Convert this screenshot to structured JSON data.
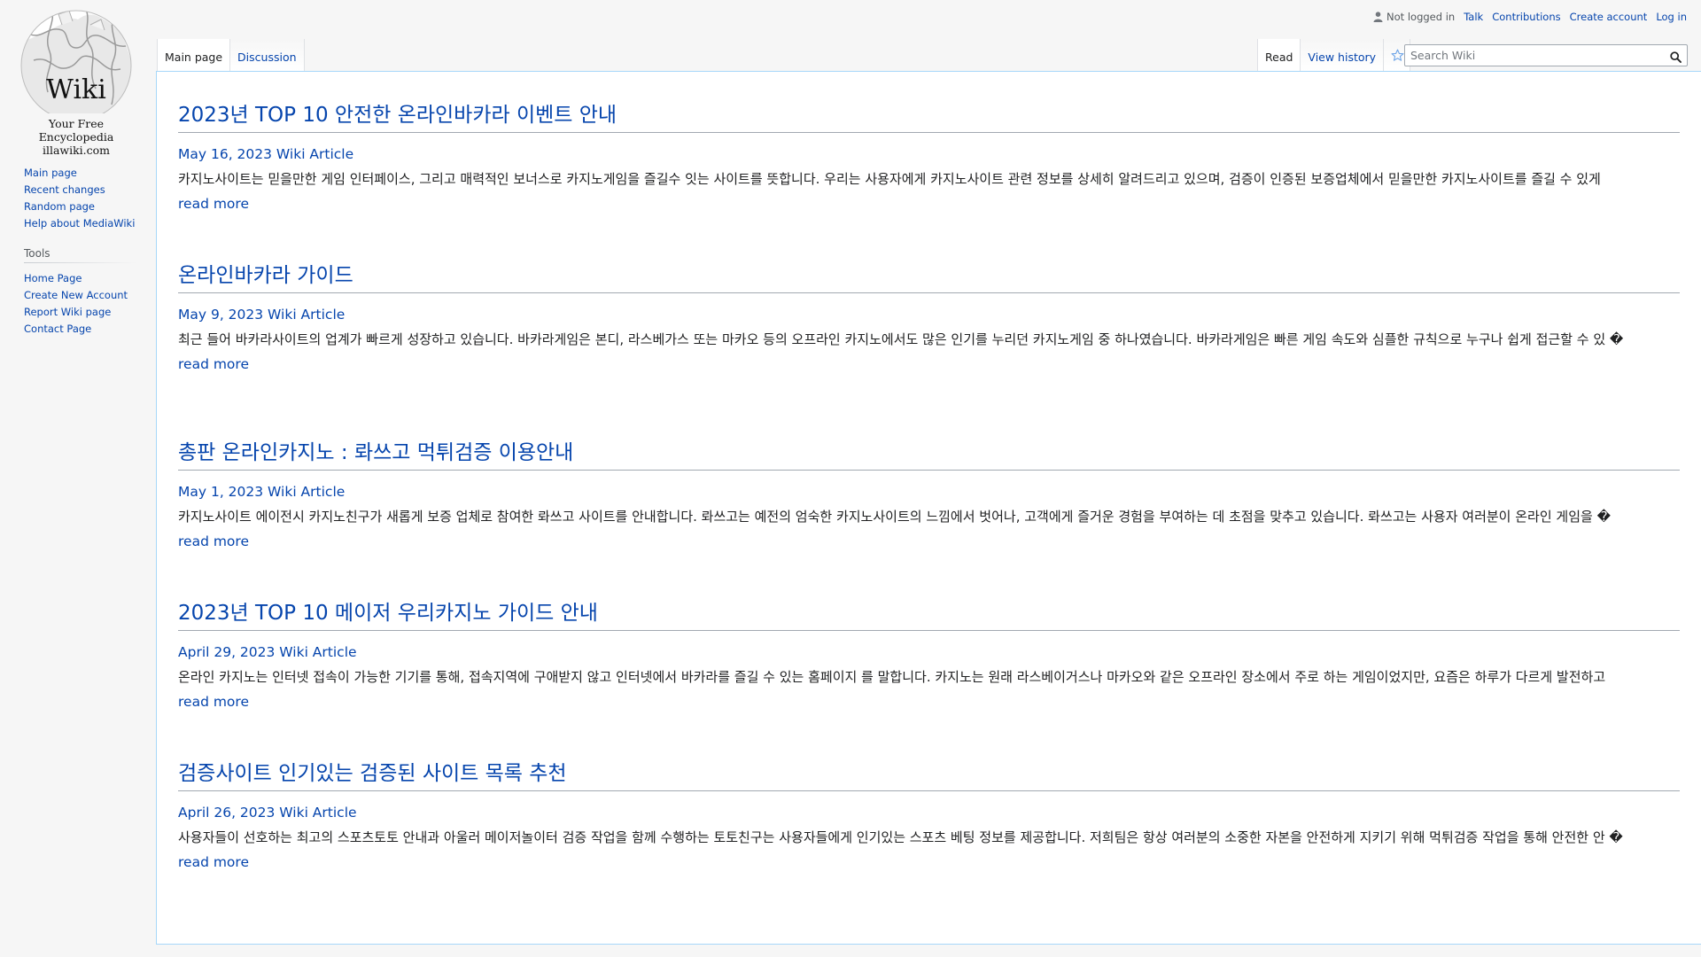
{
  "logo": {
    "word": "Wiki",
    "tagline": "Your Free Encyclopedia",
    "domain": "illawiki.com"
  },
  "sidebar": {
    "navigation": [
      {
        "label": "Main page"
      },
      {
        "label": "Recent changes"
      },
      {
        "label": "Random page"
      },
      {
        "label": "Help about MediaWiki"
      }
    ],
    "tools_heading": "Tools",
    "tools": [
      {
        "label": "Home Page"
      },
      {
        "label": "Create New Account"
      },
      {
        "label": "Report Wiki page"
      },
      {
        "label": "Contact Page"
      }
    ]
  },
  "personal": {
    "not_logged_in": "Not logged in",
    "talk": "Talk",
    "contributions": "Contributions",
    "create_account": "Create account",
    "log_in": "Log in"
  },
  "tabs": {
    "main_page": "Main page",
    "discussion": "Discussion",
    "read": "Read",
    "view_history": "View history"
  },
  "search": {
    "placeholder": "Search Wiki"
  },
  "articles": [
    {
      "title": "2023년 TOP 10 안전한 온라인바카라 이벤트 안내",
      "meta": "May 16, 2023 Wiki Article",
      "excerpt": "카지노사이트는  믿을만한 게임 인터페이스, 그리고 매력적인 보너스로 카지노게임을 즐길수 잇는 사이트를 뜻합니다. 우리는 사용자에게 카지노사이트 관련 정보를 상세히 알려드리고 있으며, 검증이 인증된 보증업체에서 믿을만한 카지노사이트를 즐길 수 있게",
      "read_more": "read more"
    },
    {
      "title": "온라인바카라 가이드",
      "meta": "May 9, 2023 Wiki Article",
      "excerpt": "최근 들어 바카라사이트의 업계가 빠르게 성장하고 있습니다. 바카라게임은 본디, 라스베가스 또는 마카오 등의 오프라인 카지노에서도 많은 인기를 누리던 카지노게임 중 하나였습니다. 바카라게임은 빠른 게임 속도와 심플한 규칙으로 누구나 쉽게 접근할 수 있 �",
      "read_more": "read more"
    },
    {
      "title": "총판 온라인카지노 : 롸쓰고 먹튀검증 이용안내",
      "meta": "May 1, 2023 Wiki Article",
      "excerpt": "카지노사이트 에이전시 카지노친구가 새롭게 보증 업체로 참여한 롸쓰고 사이트를 안내합니다. 롸쓰고는 예전의 엄숙한 카지노사이트의 느낌에서 벗어나, 고객에게 즐거운 경험을 부여하는 데 초점을 맞추고 있습니다. 롸쓰고는 사용자 여러분이 온라인 게임을 �",
      "read_more": "read more"
    },
    {
      "title": "2023년 TOP 10 메이저 우리카지노 가이드 안내",
      "meta": "April 29, 2023 Wiki Article",
      "excerpt": "온라인 카지노는 인터넷 접속이 가능한 기기를 통해, 접속지역에 구애받지 않고 인터넷에서 바카라를 즐길 수 있는 홈페이지 를 말합니다. 카지노는 원래 라스베이거스나 마카오와 같은 오프라인 장소에서 주로 하는 게임이었지만, 요즘은 하루가 다르게 발전하고",
      "read_more": "read more"
    },
    {
      "title": "검증사이트 인기있는 검증된 사이트 목록 추천",
      "meta": "April 26, 2023 Wiki Article",
      "excerpt": "사용자들이 선호하는 최고의 스포츠토토 안내과 아울러 메이저놀이터 검증 작업을 함께 수행하는 토토친구는 사용자들에게 인기있는 스포츠 베팅 정보를 제공합니다. 저희팀은 항상 여러분의 소중한 자본을 안전하게 지키기 위해 먹튀검증 작업을 통해 안전한 안 �",
      "read_more": "read more"
    }
  ]
}
